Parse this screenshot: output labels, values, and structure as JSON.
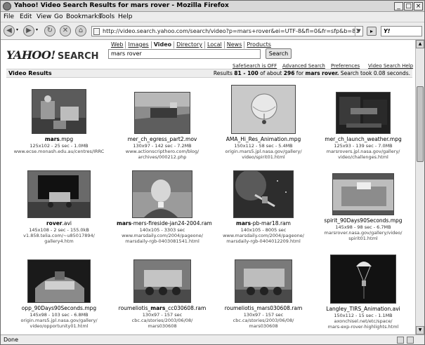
{
  "window": {
    "title": "Yahoo! Video Search Results for mars rover - Mozilla Firefox"
  },
  "menu": [
    "File",
    "Edit",
    "View",
    "Go",
    "Bookmarks",
    "Tools",
    "Help"
  ],
  "address": {
    "url": "http://video.search.yahoo.com/search/video?p=mars+rover&ei=UTF-8&fl=0&fr=sfp&b=81"
  },
  "toolbar_search": {
    "brand": "Y!"
  },
  "yahoo": {
    "logo": "YAHOO!",
    "logo_suffix": "SEARCH",
    "tabs": [
      "Web",
      "Images",
      "Video",
      "Directory",
      "Local",
      "News",
      "Products"
    ],
    "active_tab": "Video",
    "query": "mars rover",
    "search_button": "Search",
    "links": [
      "SafeSearch is OFF",
      "Advanced Search",
      "Preferences",
      "Video Search Help"
    ],
    "section_title": "Video Results",
    "results": {
      "prefix": "Results ",
      "range": "81 - 100",
      "of": " of about ",
      "total": "296",
      "for": " for ",
      "query": "mars rover.",
      "took": " Search took 0.08 seconds."
    }
  },
  "videos": [
    {
      "name_bold": "mars",
      "name_rest": ".mpg",
      "meta": "125x102 - 25 sec - 1.0MB",
      "url1": "www.ecse.monash.edu.au/centres/IRRC",
      "url2": ""
    },
    {
      "name_bold": "",
      "name_rest": "mer_ch_egress_part2.mov",
      "meta": "130x97 - 142 sec - 7.2MB",
      "url1": "www.actionscripthero.com/blog/",
      "url2": "archives/000212.php"
    },
    {
      "name_bold": "",
      "name_rest": "AMA_Hi_Res_Animation.mpg",
      "meta": "150x112 - 58 sec - 5.4MB",
      "url1": "origin.mars5.jpl.nasa.gov/gallery/",
      "url2": "video/spirit01.html"
    },
    {
      "name_bold": "",
      "name_rest": "mer_ch_launch_weather.mpg",
      "meta": "125x93 - 139 sec - 7.0MB",
      "url1": "marsrovers.jpl.nasa.gov/gallery/",
      "url2": "video/challenges.html"
    },
    {
      "name_bold": "rover",
      "name_rest": ".avi",
      "meta": "145x108 - 2 sec - 155.0kB",
      "url1": "v1.858.telia.com/~u85017894/",
      "url2": "gallery4.htm"
    },
    {
      "name_bold": "mars",
      "name_rest": "-mers-fireside-jan24-2004.ram",
      "meta": "140x105 - 3303 sec",
      "url1": "www.marsdaily.com/2004/pageone/",
      "url2": "marsdaily-rgb-0403081541.html"
    },
    {
      "name_bold": "mars",
      "name_rest": "-pb-mar18.ram",
      "meta": "140x105 - 8005 sec",
      "url1": "www.marsdaily.com/2004/pageone/",
      "url2": "marsdaily-rgb-0404012209.html"
    },
    {
      "name_bold": "",
      "name_rest": "spirit_90Days90Seconds.mpg",
      "meta": "145x98 - 98 sec - 6.7MB",
      "url1": "marsrover.nasa.gov/gallery/video/",
      "url2": "spirit01.html"
    },
    {
      "name_bold": "",
      "name_rest": "opp_90Days90Seconds.mpg",
      "meta": "145x98 - 103 sec - 6.8MB",
      "url1": "origin.mars5.jpl.nasa.gov/gallery/",
      "url2": "video/opportunity01.html"
    },
    {
      "name_bold": "",
      "name_rest": "roumeliotis_",
      "name_bold2": "mars",
      "name_rest2": "_cc030608.ram",
      "meta": "130x97 - 157 sec",
      "url1": "cbc.ca/stories/2003/06/08/",
      "url2": "mars030608"
    },
    {
      "name_bold": "",
      "name_rest": "roumeliotis_mars030608.ram",
      "meta": "130x97 - 157 sec",
      "url1": "cbc.ca/stories/2003/06/08/",
      "url2": "mars030608"
    },
    {
      "name_bold": "",
      "name_rest": "Langley_TIRS_Animation.avi",
      "meta": "150x112 - 15 sec - 1.1MB",
      "url1": "axonchisel.net/etc/space/",
      "url2": "mars-exp-rover-highlights.html"
    }
  ],
  "status": {
    "text": "Done"
  }
}
